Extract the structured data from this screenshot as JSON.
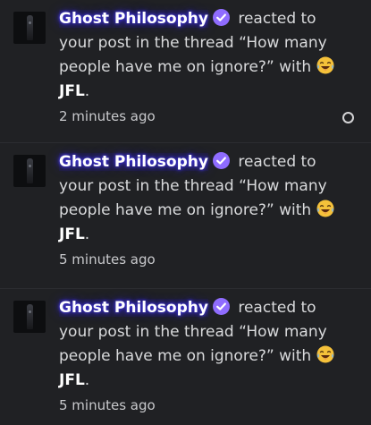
{
  "notifications": [
    {
      "username": "Ghost Philosophy",
      "action_text": "reacted to your post in the thread “How many people have me on ignore?” with",
      "reaction": "JFL",
      "reaction_suffix": ".",
      "time": "2 minutes ago",
      "unread": true
    },
    {
      "username": "Ghost Philosophy",
      "action_text": "reacted to your post in the thread “How many people have me on ignore?” with",
      "reaction": "JFL",
      "reaction_suffix": ".",
      "time": "5 minutes ago",
      "unread": false
    },
    {
      "username": "Ghost Philosophy",
      "action_text": "reacted to your post in the thread “How many people have me on ignore?” with",
      "reaction": "JFL",
      "reaction_suffix": ".",
      "time": "5 minutes ago",
      "unread": false
    }
  ],
  "icons": {
    "verified": "verified-check-icon",
    "reaction": "crying-laughing-emoji-icon",
    "unread": "unread-indicator-icon"
  },
  "colors": {
    "background": "#202124",
    "username_glow": "#3a2fd0",
    "verified_badge": "#8f6cff",
    "text": "#d9dadc"
  }
}
